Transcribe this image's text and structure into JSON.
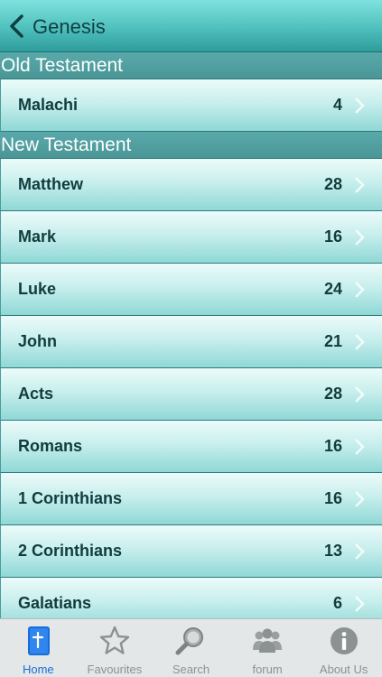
{
  "navbar": {
    "back_label": "Genesis"
  },
  "sections": [
    {
      "title": "Old Testament",
      "books": [
        {
          "name": "Malachi",
          "chapters": "4"
        }
      ]
    },
    {
      "title": "New Testament",
      "books": [
        {
          "name": "Matthew",
          "chapters": "28"
        },
        {
          "name": "Mark",
          "chapters": "16"
        },
        {
          "name": "Luke",
          "chapters": "24"
        },
        {
          "name": "John",
          "chapters": "21"
        },
        {
          "name": "Acts",
          "chapters": "28"
        },
        {
          "name": "Romans",
          "chapters": "16"
        },
        {
          "name": "1 Corinthians",
          "chapters": "16"
        },
        {
          "name": "2 Corinthians",
          "chapters": "13"
        },
        {
          "name": "Galatians",
          "chapters": "6"
        }
      ]
    }
  ],
  "tabbar": {
    "tabs": [
      {
        "label": "Home",
        "icon": "bible-book-icon",
        "active": true
      },
      {
        "label": "Favourites",
        "icon": "star-icon",
        "active": false
      },
      {
        "label": "Search",
        "icon": "magnifier-icon",
        "active": false
      },
      {
        "label": "forum",
        "icon": "people-icon",
        "active": false
      },
      {
        "label": "About Us",
        "icon": "info-icon",
        "active": false
      }
    ]
  },
  "colors": {
    "active_tab": "#1a6cd8",
    "inactive_tab": "#8c9192",
    "navbar_text": "#0f3f42"
  }
}
